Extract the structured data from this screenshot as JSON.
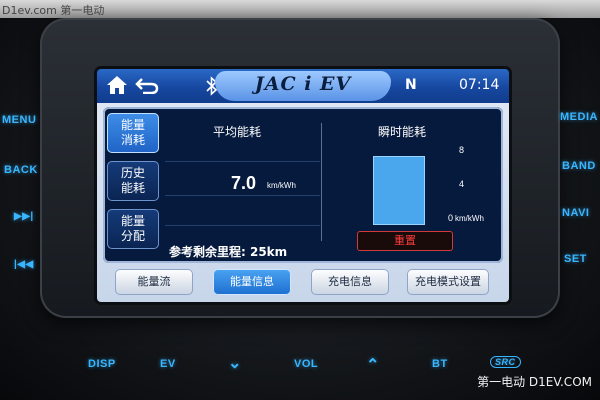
{
  "watermarks": {
    "top": "D1ev.com 第一电动",
    "bottom": "第一电动 D1EV.COM"
  },
  "hardware": {
    "left": [
      "MENU",
      "BACK",
      "▶▶|",
      "|◀◀"
    ],
    "right": [
      "MEDIA",
      "BAND",
      "NAVI",
      "SET"
    ],
    "bottom": [
      "DISP",
      "EV",
      "VOL",
      "BT",
      "SRC"
    ]
  },
  "topbar": {
    "title": "JAC i EV",
    "gear": "N",
    "time": "07:14"
  },
  "side_menu": [
    {
      "line1": "能量",
      "line2": "消耗",
      "active": true
    },
    {
      "line1": "历史",
      "line2": "能耗",
      "active": false
    },
    {
      "line1": "能量",
      "line2": "分配",
      "active": false
    }
  ],
  "average": {
    "title": "平均能耗",
    "value": "7.0",
    "unit": "km/kWh"
  },
  "instant": {
    "title": "瞬时能耗",
    "ticks": [
      "8",
      "4",
      "0"
    ],
    "unit": "km/kWh",
    "bar_value": 6.9,
    "max": 8
  },
  "range": {
    "label": "参考剩余里程: 25km"
  },
  "reset_label": "重置",
  "tabs": [
    {
      "label": "能量流",
      "active": false
    },
    {
      "label": "能量信息",
      "active": true
    },
    {
      "label": "充电信息",
      "active": false
    },
    {
      "label": "充电模式设置",
      "active": false
    }
  ],
  "colors": {
    "accent": "#1f63c6",
    "bar": "#4aa7ee",
    "reset": "#ff3b3b"
  }
}
